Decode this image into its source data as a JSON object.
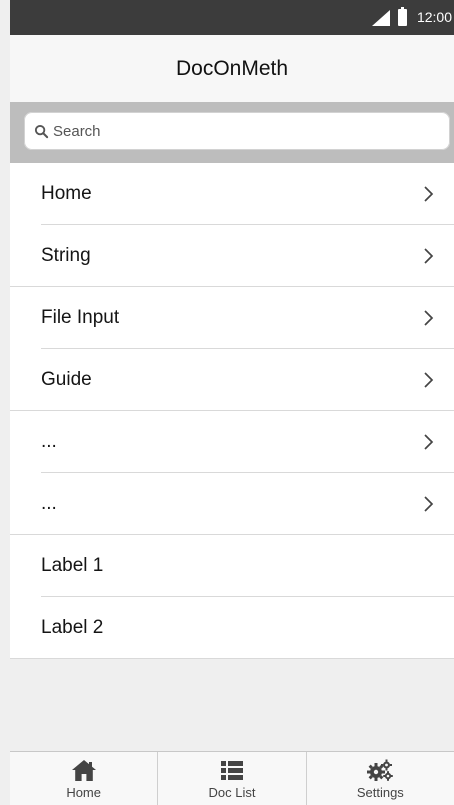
{
  "status_bar": {
    "time": "12:00"
  },
  "app": {
    "title": "DocOnMeth"
  },
  "search": {
    "placeholder": "Search",
    "value": ""
  },
  "menu": {
    "items": [
      {
        "label": "Home",
        "icon": "chevron-right-icon"
      },
      {
        "label": "String",
        "icon": "chevron-right-icon"
      },
      {
        "label": "File Input",
        "icon": "chevron-right-icon"
      },
      {
        "label": "Guide",
        "icon": "chevron-right-icon"
      },
      {
        "label": "...",
        "icon": "chevron-right-icon"
      },
      {
        "label": "...",
        "icon": "chevron-right-icon"
      }
    ],
    "labels": [
      {
        "label": "Label 1"
      },
      {
        "label": "Label 2"
      }
    ]
  },
  "bottom_nav": {
    "items": [
      {
        "label": "Home",
        "icon": "home-icon"
      },
      {
        "label": "Doc List",
        "icon": "list-icon"
      },
      {
        "label": "Settings",
        "icon": "gears-icon"
      }
    ]
  },
  "colors": {
    "status_bar": "#3c3c3c",
    "search_band": "#bdbdbd",
    "background": "#efefef",
    "text": "#151515",
    "icon": "#444444"
  }
}
